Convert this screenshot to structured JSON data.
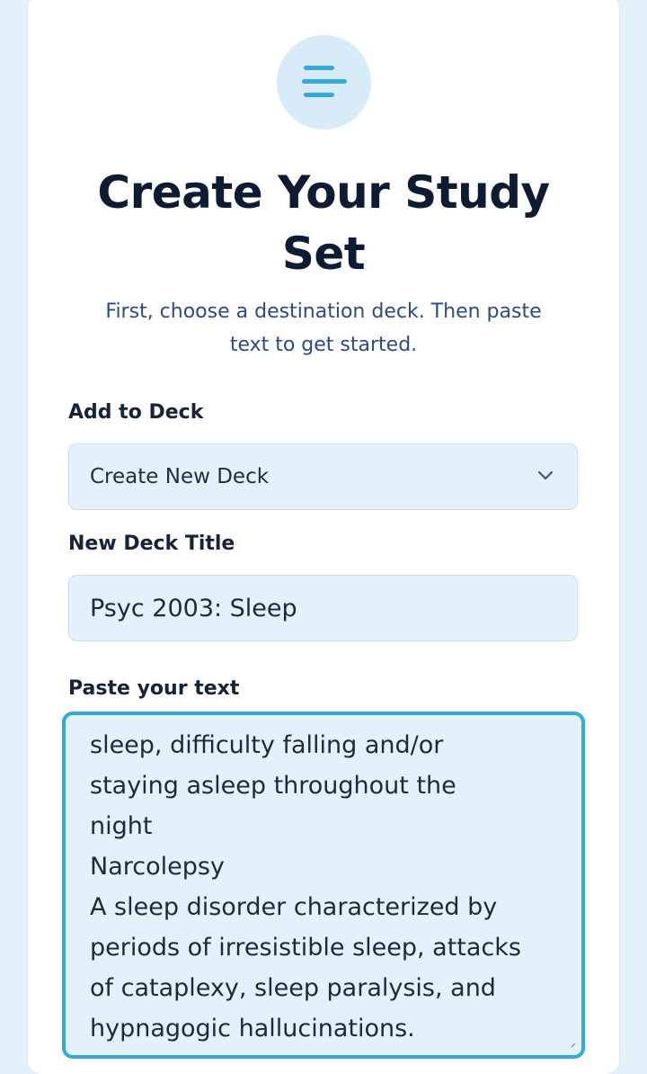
{
  "header": {
    "icon": "menu-lines-icon",
    "title_line1": "Create Your Study",
    "title_line2": "Set",
    "subtitle_line1": "First, choose a destination deck. Then paste",
    "subtitle_line2": "text to get started."
  },
  "deck_select": {
    "label": "Add to Deck",
    "selected": "Create New Deck",
    "icon": "chevron-down-icon"
  },
  "deck_title": {
    "label": "New Deck Title",
    "value": "Psyc 2003: Sleep"
  },
  "paste_text": {
    "label": "Paste your text",
    "lines": [
      "sleep, difficulty falling and/or",
      "staying asleep throughout the",
      "night",
      "Narcolepsy",
      "A sleep disorder characterized by",
      "periods of irresistible sleep, attacks",
      "of cataplexy, sleep paralysis, and",
      "hypnagogic hallucinations."
    ]
  },
  "colors": {
    "accent": "#35a9dd",
    "field_bg": "#e3f1fb",
    "title": "#0d1b33",
    "subtitle": "#2b4a86"
  }
}
